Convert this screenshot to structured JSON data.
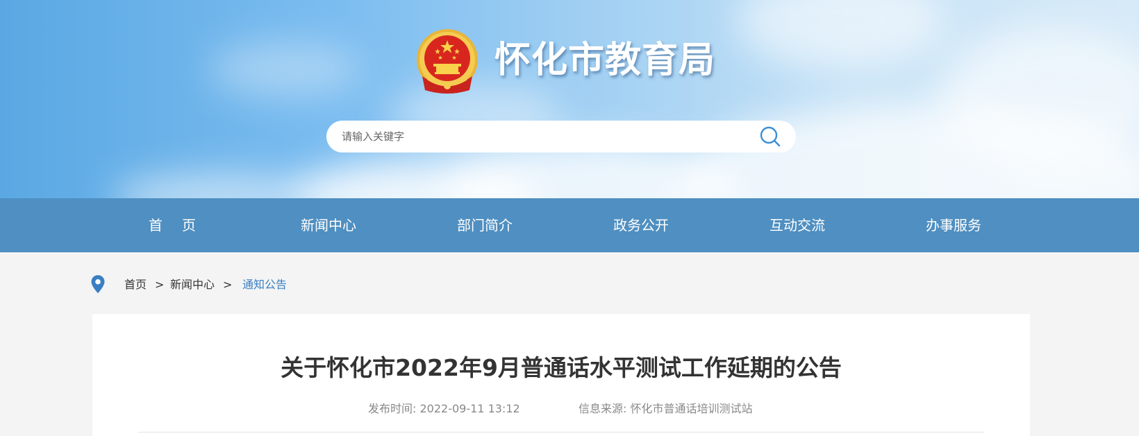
{
  "header": {
    "site_title": "怀化市教育局",
    "emblem_icon": "national-emblem-icon",
    "search": {
      "placeholder": "请输入关键字",
      "value": "",
      "button_icon": "search-icon"
    }
  },
  "nav": {
    "items": [
      {
        "label": "首页"
      },
      {
        "label": "新闻中心"
      },
      {
        "label": "部门简介"
      },
      {
        "label": "政务公开"
      },
      {
        "label": "互动交流"
      },
      {
        "label": "办事服务"
      }
    ],
    "background_color": "#4f8fc1"
  },
  "breadcrumb": {
    "icon": "location-pin-icon",
    "items": [
      {
        "label": "首页"
      },
      {
        "label": "新闻中心"
      },
      {
        "label": "通知公告"
      }
    ],
    "separator": ">",
    "current_color": "#3a7fc2"
  },
  "article": {
    "title": "关于怀化市2022年9月普通话水平测试工作延期的公告",
    "publish_time_label": "发布时间:",
    "publish_time": "2022-09-11 13:12",
    "source_label": "信息来源:",
    "source": "怀化市普通话培训测试站"
  }
}
